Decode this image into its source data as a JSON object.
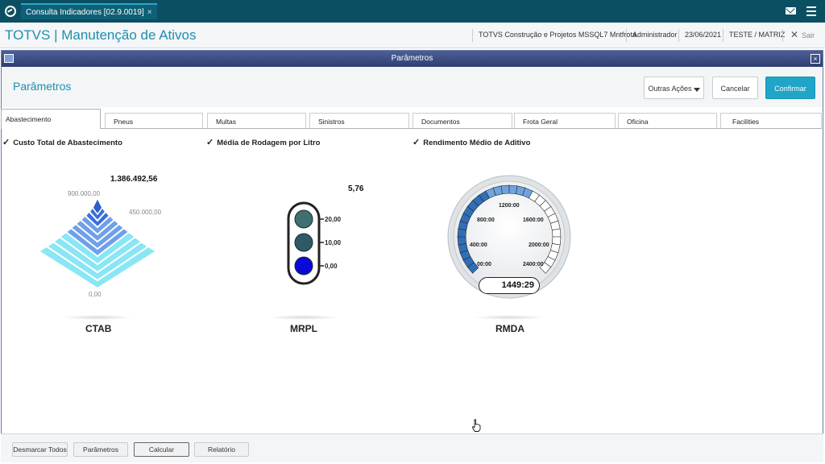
{
  "topbar": {
    "app_tab_label": "Consulta Indicadores [02.9.0019]",
    "close_glyph": "×",
    "icons": [
      "totvs-logo-icon",
      "mail-icon",
      "menu-icon"
    ]
  },
  "header": {
    "title": "TOTVS | Manutenção de Ativos",
    "company": "TOTVS Construção e Projetos MSSQL7 Mntfrota",
    "user": "Administrador",
    "date": "23/06/2021",
    "branch": "TESTE / MATRIZ",
    "exit_glyph": "✕",
    "exit_label": "Sair"
  },
  "dialog": {
    "title": "Parâmetros",
    "close_glyph": "×",
    "page_title": "Parâmetros",
    "actions": {
      "more_actions": "Outras Ações",
      "cancel": "Cancelar",
      "confirm": "Confirmar"
    }
  },
  "tabs": [
    {
      "label": "Abastecimento",
      "active": true
    },
    {
      "label": "Pneus"
    },
    {
      "label": "Multas"
    },
    {
      "label": "Sinistros"
    },
    {
      "label": "Documentos"
    },
    {
      "label": "Frota Geral"
    },
    {
      "label": "Oficina"
    },
    {
      "label": "Facilities"
    }
  ],
  "indicators": {
    "ctab": {
      "checkbox_label": "Custo Total de Abastecimento",
      "checked": true,
      "value": "1.386.492,56",
      "scale": [
        "900.000,00",
        "450.000,00",
        "0,00"
      ],
      "name": "CTAB",
      "colors": {
        "level_dark": "#3a6fd8",
        "level_mid": "#6fa0ea",
        "level_light": "#8ae6f5",
        "outline": "#ffffff"
      }
    },
    "mrpl": {
      "checkbox_label": "Média de Rodagem por Litro",
      "checked": true,
      "value": "5,76",
      "scale": [
        "20,00",
        "10,00",
        "0,00"
      ],
      "name": "MRPL",
      "colors": {
        "top": "#3f6f70",
        "middle": "#2e5a66",
        "bottom": "#0a0ad8"
      }
    },
    "rmda": {
      "checkbox_label": "Rendimento Médio de Aditivo",
      "checked": true,
      "value": "1449:29",
      "scale": [
        "00:00",
        "400:00",
        "800:00",
        "1200:00",
        "1600:00",
        "2000:00",
        "2400:00"
      ],
      "fill_fraction": 0.6,
      "name": "RMDA",
      "colors": {
        "fill": "#2f6fb8",
        "fill_light": "#6fa3e0",
        "empty": "#ffffff"
      }
    }
  },
  "footer": {
    "uncheck_all": "Desmarcar Todos",
    "params": "Parâmetros",
    "calculate": "Calcular",
    "report": "Relatório"
  }
}
